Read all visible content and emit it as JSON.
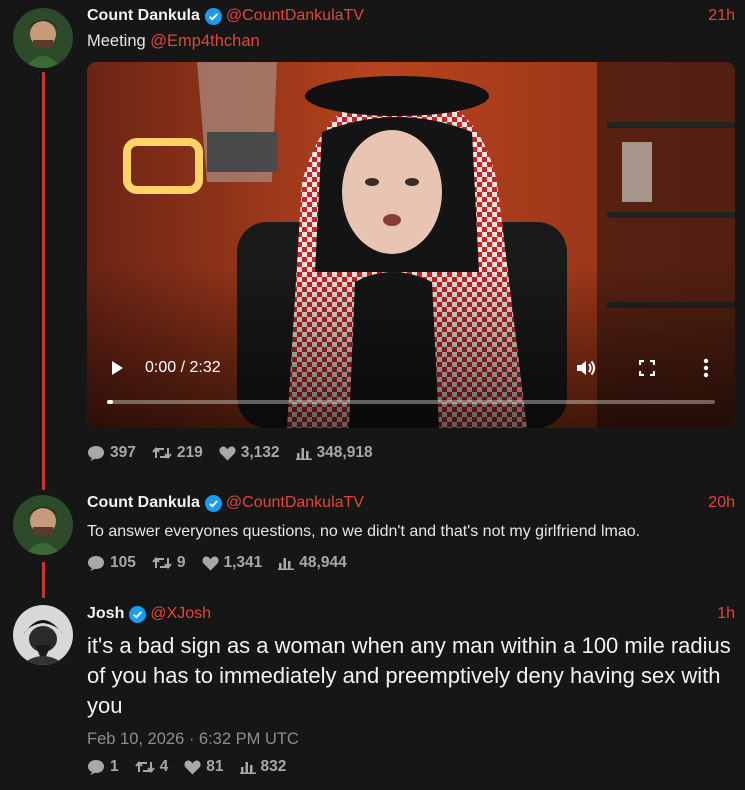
{
  "colors": {
    "background": "#161616",
    "accent": "#e0463a",
    "thread_line": "#c0392b",
    "stats": "#a8a8a8"
  },
  "tweets": [
    {
      "name": "Count Dankula",
      "handle": "@CountDankulaTV",
      "time": "21h",
      "text_prefix": "Meeting ",
      "mention": "@Emp4thchan",
      "video": {
        "time_display": "0:00 / 2:32",
        "progress_fraction": 0.01
      },
      "stats": {
        "replies": "397",
        "retweets": "219",
        "likes": "3,132",
        "views": "348,918"
      }
    },
    {
      "name": "Count Dankula",
      "handle": "@CountDankulaTV",
      "time": "20h",
      "text": "To answer everyones questions, no we didn't and that's not my girlfriend lmao.",
      "stats": {
        "replies": "105",
        "retweets": "9",
        "likes": "1,341",
        "views": "48,944"
      }
    },
    {
      "name": "Josh",
      "handle": "@XJosh",
      "time": "1h",
      "text": "it's a bad sign as a woman when any man within a 100 mile radius of you has to immediately and preemptively deny having sex with you",
      "date": "Feb 10, 2026 · 6:32 PM UTC",
      "stats": {
        "replies": "1",
        "retweets": "4",
        "likes": "81",
        "views": "832"
      }
    }
  ]
}
